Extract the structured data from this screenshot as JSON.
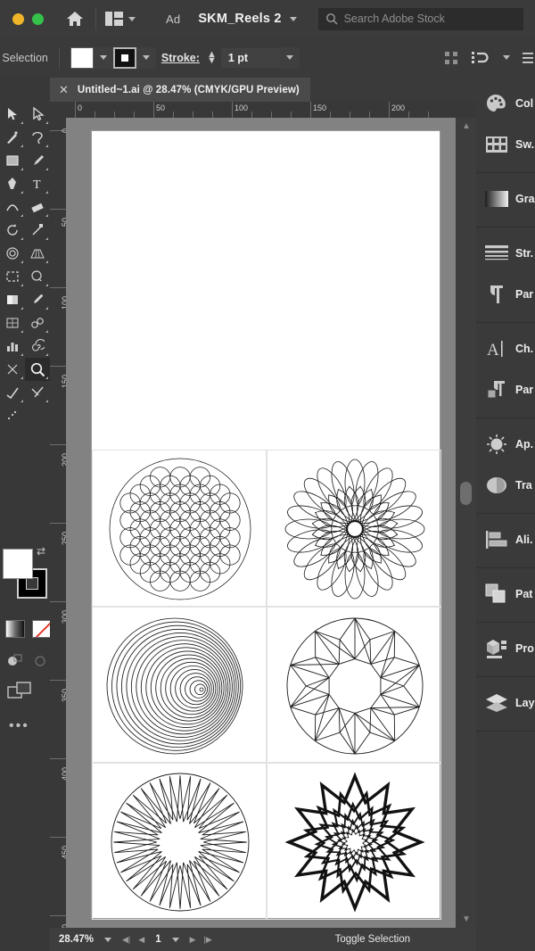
{
  "titlebar": {
    "home_icon": "home-icon",
    "workspace_icon": "workspace-grid-icon",
    "ad_label": "Ad",
    "document_name": "SKM_Reels 2",
    "search": {
      "icon": "search-icon",
      "placeholder": "Search Adobe Stock"
    }
  },
  "controlbar": {
    "selection_status": "o Selection",
    "fill_swatch_color": "#ffffff",
    "stroke_label": "Stroke:",
    "stroke_value": "1 pt",
    "right_icons": [
      "transform-icon",
      "align-icon",
      "options-icon"
    ]
  },
  "document_tab": {
    "close_icon": "close-icon",
    "title": "Untitled~1.ai @ 28.47% (CMYK/GPU Preview)"
  },
  "toolbar": {
    "tools": [
      {
        "name": "selection-tool",
        "glyph": "▲"
      },
      {
        "name": "direct-selection-tool",
        "glyph": "➤"
      },
      {
        "name": "magic-wand-tool",
        "glyph": "✦"
      },
      {
        "name": "lasso-tool",
        "glyph": "✧"
      },
      {
        "name": "pen-tool",
        "glyph": "✒"
      },
      {
        "name": "curvature-tool",
        "glyph": "◞"
      },
      {
        "name": "type-tool",
        "glyph": "T"
      },
      {
        "name": "line-segment-tool",
        "glyph": "╱"
      },
      {
        "name": "rectangle-tool",
        "glyph": "▭"
      },
      {
        "name": "paintbrush-tool",
        "glyph": "🖌"
      },
      {
        "name": "shaper-tool",
        "glyph": "◠"
      },
      {
        "name": "pencil-tool",
        "glyph": "✎"
      },
      {
        "name": "eraser-tool",
        "glyph": "◻"
      },
      {
        "name": "rotate-tool",
        "glyph": "↻"
      },
      {
        "name": "scale-tool",
        "glyph": "⤢"
      },
      {
        "name": "width-tool",
        "glyph": "◇"
      },
      {
        "name": "free-transform-tool",
        "glyph": "⬚"
      },
      {
        "name": "shape-builder-tool",
        "glyph": "◐"
      },
      {
        "name": "perspective-grid-tool",
        "glyph": "▦"
      },
      {
        "name": "mesh-tool",
        "glyph": "▨"
      },
      {
        "name": "gradient-tool",
        "glyph": "▤"
      },
      {
        "name": "eyedropper-tool",
        "glyph": "⚲"
      },
      {
        "name": "blend-tool",
        "glyph": "◉"
      },
      {
        "name": "symbol-sprayer-tool",
        "glyph": "❀"
      },
      {
        "name": "column-graph-tool",
        "glyph": "▥"
      },
      {
        "name": "artboard-tool",
        "glyph": "⬒"
      },
      {
        "name": "slice-tool",
        "glyph": "✂"
      },
      {
        "name": "spiral-tool",
        "glyph": "◎"
      },
      {
        "name": "zoom-tool",
        "glyph": "🔍",
        "selected": true
      },
      {
        "name": "hand-tool",
        "glyph": "✋"
      }
    ],
    "fill_color": "#ffffff",
    "stroke_color": "#000000",
    "swap_icon": "swap-fill-stroke-icon",
    "color_modes": [
      "gradient-swatch",
      "none-swatch"
    ],
    "draw_modes": [
      "draw-normal-icon",
      "draw-behind-icon"
    ],
    "screen_mode_icon": "screen-mode-icon",
    "more_tools_icon": "more-tools-icon"
  },
  "rulers": {
    "horizontal_ticks": [
      "0",
      "50",
      "100",
      "150",
      "200"
    ],
    "vertical_ticks": [
      "0",
      "50",
      "100",
      "150",
      "200",
      "250",
      "300",
      "350",
      "400",
      "450",
      "500"
    ]
  },
  "artwork": [
    {
      "name": "flower-of-life-pattern",
      "row": 0,
      "col": 0
    },
    {
      "name": "spirograph-rosette",
      "row": 0,
      "col": 1
    },
    {
      "name": "eccentric-concentric-circles",
      "row": 1,
      "col": 0
    },
    {
      "name": "ten-point-star-mandala",
      "row": 1,
      "col": 1
    },
    {
      "name": "twenty-point-sunburst-star",
      "row": 2,
      "col": 0
    },
    {
      "name": "nested-twelve-point-star-mandala",
      "row": 2,
      "col": 1
    }
  ],
  "dock": {
    "groups": [
      {
        "items": [
          {
            "icon": "color-palette-icon",
            "label": "Col"
          },
          {
            "icon": "swatches-icon",
            "label": "Sw."
          }
        ]
      },
      {
        "items": [
          {
            "icon": "gradient-icon",
            "label": "Gra"
          }
        ]
      },
      {
        "items": [
          {
            "icon": "stroke-icon",
            "label": "Str."
          },
          {
            "icon": "paragraph-icon",
            "label": "Par"
          }
        ]
      },
      {
        "items": [
          {
            "icon": "character-icon",
            "label": "Ch."
          },
          {
            "icon": "paragraph-styles-icon",
            "label": "Par"
          }
        ]
      },
      {
        "items": [
          {
            "icon": "appearance-icon",
            "label": "Ap."
          },
          {
            "icon": "transparency-icon",
            "label": "Tra"
          }
        ]
      },
      {
        "items": [
          {
            "icon": "align-icon",
            "label": "Ali."
          }
        ]
      },
      {
        "items": [
          {
            "icon": "pathfinder-icon",
            "label": "Pat"
          }
        ]
      },
      {
        "items": [
          {
            "icon": "properties-icon",
            "label": "Pro"
          }
        ]
      },
      {
        "items": [
          {
            "icon": "layers-icon",
            "label": "Lay"
          }
        ]
      }
    ]
  },
  "statusbar": {
    "zoom_level": "28.47%",
    "page_number": "1",
    "tool_status": "Toggle Selection",
    "nav_icons": [
      "first-page-icon",
      "prev-page-icon",
      "next-page-icon",
      "last-page-icon"
    ]
  }
}
